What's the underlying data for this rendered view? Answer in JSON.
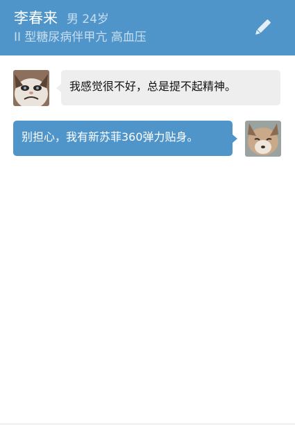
{
  "header": {
    "name": "李春来",
    "meta": "男 24岁",
    "diagnosis": "II 型糖尿病伴甲亢 高血压",
    "edit_icon": "pencil-icon",
    "background": "#4f95c9"
  },
  "messages": [
    {
      "direction": "incoming",
      "avatar": "grumpy-cat-avatar",
      "text": "我感觉很不好，总是提不起精神。"
    },
    {
      "direction": "outgoing",
      "avatar": "fox-avatar",
      "text": "别担心，我有新苏菲360弹力贴身。"
    }
  ],
  "colors": {
    "accent": "#4f95c9",
    "incoming_bubble": "#eeeeee",
    "outgoing_text": "#ffffff"
  }
}
